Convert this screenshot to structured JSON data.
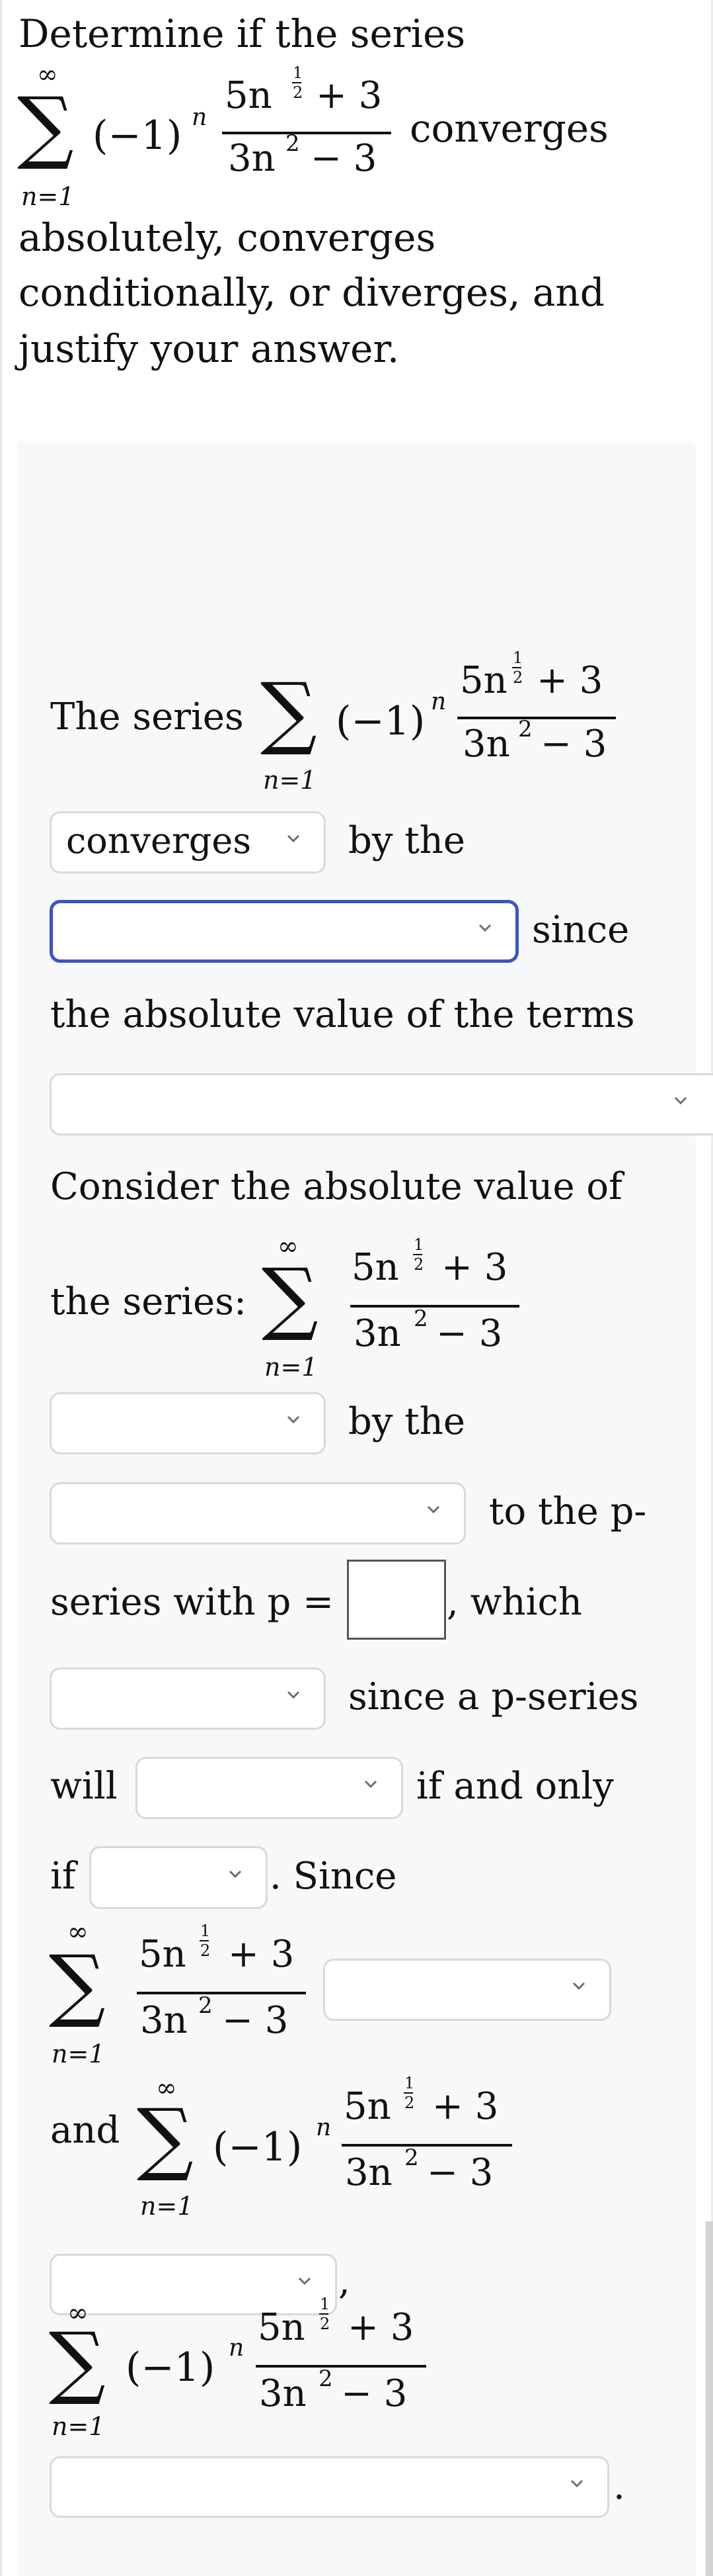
{
  "question": {
    "line1": "Determine if the series",
    "after_series": "converges",
    "line2": "absolutely, converges",
    "line3": "conditionally, or diverges, and",
    "line4": "justify your answer."
  },
  "math": {
    "sum_symbol": "∑",
    "upper_limit": "∞",
    "lower_limit": "n=1",
    "sign_factor": "(−1)",
    "sign_exponent": "n",
    "numerator_coef": "5n",
    "numerator_exp_num": "1",
    "numerator_exp_den": "2",
    "numerator_rest": "+ 3",
    "denominator_base": "3n",
    "denominator_exp": "2",
    "denominator_rest": "− 3"
  },
  "answer": {
    "the_series_label": "The series",
    "select1": {
      "value": "converges",
      "suffix": "by the"
    },
    "select2": {
      "value": "",
      "suffix": "since",
      "focused": true
    },
    "abs_terms_text": "the absolute value of the terms",
    "select3": {
      "value": ""
    },
    "consider_text": "Consider the absolute value of",
    "the_series_colon": "the series:",
    "select4": {
      "value": "",
      "suffix": "by the"
    },
    "select5": {
      "value": "",
      "suffix": "to the p-"
    },
    "p_series_text": "series with p =",
    "p_value": "",
    "which_text": ", which",
    "select6": {
      "value": "",
      "suffix": "since a p-series"
    },
    "will_text": "will",
    "select7": {
      "value": "",
      "suffix": "if and only"
    },
    "if_text": "if",
    "select8": {
      "value": "",
      "suffix": ". Since"
    },
    "select9": {
      "value": ""
    },
    "and_text": "and",
    "select10": {
      "value": "",
      "suffix": ","
    },
    "select11": {
      "value": "",
      "suffix": "."
    }
  },
  "icons": {
    "dropdown": "chevron-down-icon"
  },
  "colors": {
    "focus": "#3a55c3",
    "panel_bg": "#f7f8fa",
    "select_border": "#d9d9d9",
    "chevron": "#6b6e76"
  }
}
